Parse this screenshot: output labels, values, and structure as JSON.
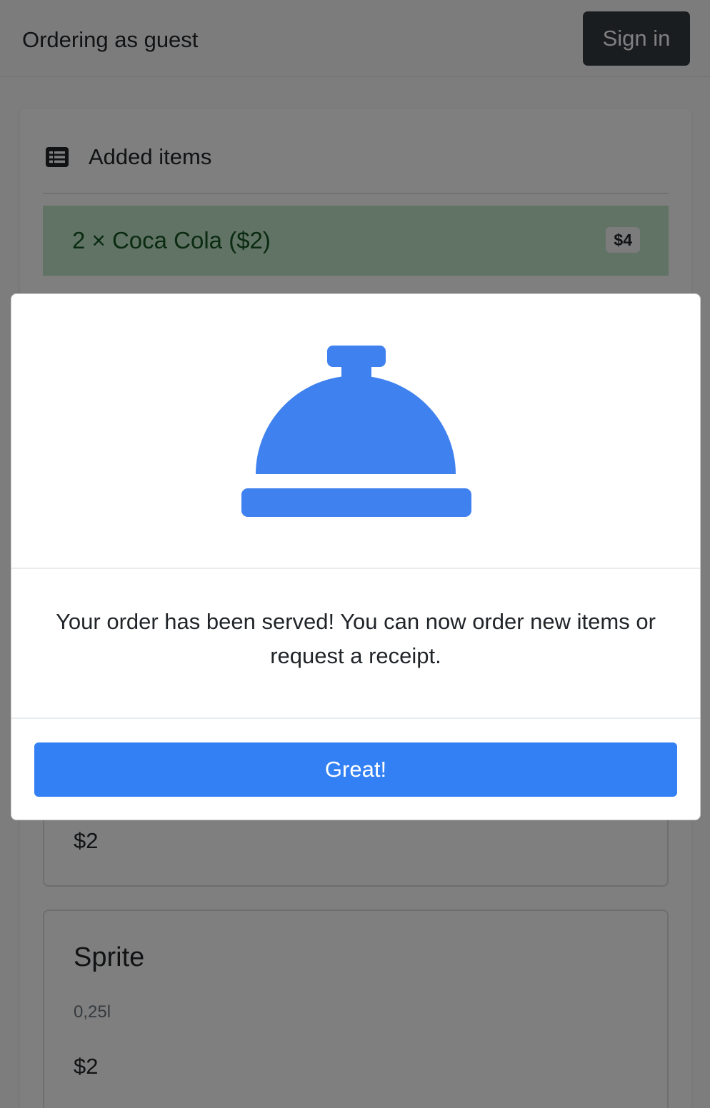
{
  "navbar": {
    "guest_text": "Ordering as guest",
    "sign_in_label": "Sign in"
  },
  "added_items": {
    "title": "Added items",
    "items": [
      {
        "text": "2 × Coca Cola ($2)",
        "total": "$4"
      }
    ]
  },
  "products": [
    {
      "price": "$2"
    },
    {
      "name": "Sprite",
      "description": "0,25l",
      "price": "$2"
    }
  ],
  "modal": {
    "icon": "concierge-bell-icon",
    "message": "Your order has been served! You can now order new items or request a receipt.",
    "button_label": "Great!"
  },
  "colors": {
    "accent": "#3380f4",
    "bell": "#3f81ef",
    "success_bg": "#c3e6cb",
    "dark_button": "#343a40"
  }
}
